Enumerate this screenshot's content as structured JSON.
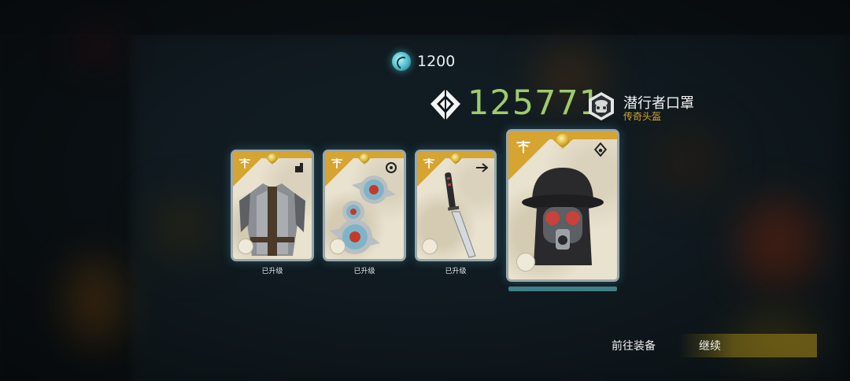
{
  "currency": {
    "icon": "cyan-swirl-coin-icon",
    "value": "1200"
  },
  "score": {
    "icon": "diamond-rank-icon",
    "value": "125771"
  },
  "featured_item": {
    "name": "潜行者口罩",
    "type": "传奇头盔",
    "badge_icon": "stalker-mask-badge-icon"
  },
  "cards": [
    {
      "name": "armor-vest",
      "art_icon": "armor-vest-icon",
      "type_icon": "body-slot-icon",
      "label": "已升级"
    },
    {
      "name": "shuriken",
      "art_icon": "throwing-stars-icon",
      "type_icon": "ranged-slot-icon",
      "label": "已升级"
    },
    {
      "name": "dagger",
      "art_icon": "knife-icon",
      "type_icon": "melee-slot-icon",
      "label": "已升级"
    },
    {
      "name": "helmet",
      "art_icon": "gas-mask-helmet-icon",
      "type_icon": "helmet-slot-icon",
      "label": ""
    }
  ],
  "buttons": {
    "go_equip": "前往装备",
    "continue": "继续"
  },
  "colors": {
    "score_green": "#9fcb6c",
    "legendary_gold": "#d4a832",
    "card_gold": "#d6a430",
    "glow_cyan": "#5cc6d4"
  }
}
